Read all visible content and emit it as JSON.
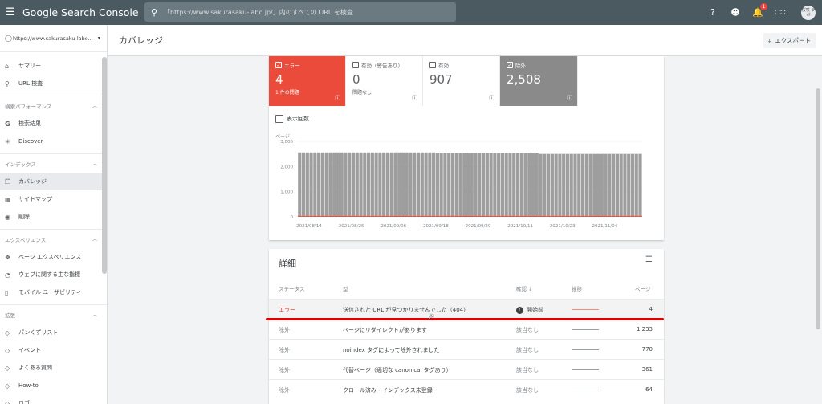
{
  "header": {
    "brand": "Google Search Console",
    "search_placeholder": "「https://www.sakurasaku-labo.jp/」内のすべての URL を検査",
    "notification_count": "1",
    "avatar_text": "桜咲 ラボ"
  },
  "sidebar": {
    "property": "https://www.sakurasaku-labo...",
    "top_items": [
      {
        "label": "サマリー",
        "icon": "home-icon"
      },
      {
        "label": "URL 検査",
        "icon": "search-icon"
      }
    ],
    "sections": [
      {
        "title": "検索パフォーマンス",
        "items": [
          {
            "label": "検索結果",
            "icon": "google-g-icon"
          },
          {
            "label": "Discover",
            "icon": "asterisk-icon"
          }
        ]
      },
      {
        "title": "インデックス",
        "items": [
          {
            "label": "カバレッジ",
            "icon": "file-copy-icon"
          },
          {
            "label": "サイトマップ",
            "icon": "sitemap-icon"
          },
          {
            "label": "削除",
            "icon": "eye-off-icon"
          }
        ]
      },
      {
        "title": "エクスペリエンス",
        "items": [
          {
            "label": "ページ エクスペリエンス",
            "icon": "target-icon"
          },
          {
            "label": "ウェブに関する主な指標",
            "icon": "speed-icon"
          },
          {
            "label": "モバイル ユーザビリティ",
            "icon": "phone-icon"
          }
        ]
      },
      {
        "title": "拡張",
        "items": [
          {
            "label": "パンくずリスト",
            "icon": "diamond-icon"
          },
          {
            "label": "イベント",
            "icon": "diamond-icon"
          },
          {
            "label": "よくある質問",
            "icon": "diamond-icon"
          },
          {
            "label": "How-to",
            "icon": "diamond-icon"
          },
          {
            "label": "ロゴ",
            "icon": "diamond-icon"
          }
        ]
      }
    ]
  },
  "page": {
    "title": "カバレッジ",
    "export_label": "エクスポート"
  },
  "tiles": [
    {
      "label": "エラー",
      "value": "4",
      "sub": "1 件の問題",
      "checked": true
    },
    {
      "label": "有効（警告あり）",
      "value": "0",
      "sub": "問題なし",
      "checked": false
    },
    {
      "label": "有効",
      "value": "907",
      "sub": "",
      "checked": false
    },
    {
      "label": "除外",
      "value": "2,508",
      "sub": "",
      "checked": true
    }
  ],
  "impressions_label": "表示回数",
  "chart_data": {
    "type": "bar",
    "ylabel": "ページ",
    "yticks": [
      "3,000",
      "2,000",
      "1,000",
      "0"
    ],
    "ylim": [
      0,
      3000
    ],
    "xticks": [
      "2021/08/14",
      "2021/08/25",
      "2021/09/06",
      "2021/09/18",
      "2021/09/29",
      "2021/10/11",
      "2021/10/23",
      "2021/11/04"
    ],
    "series": [
      {
        "name": "除外",
        "color": "#9e9e9e",
        "values_start": 2560,
        "values_mid": 2530,
        "values_end": 2500
      },
      {
        "name": "エラー",
        "color": "#eb4b3a",
        "values_start": 4,
        "values_mid": 4,
        "values_end": 4
      }
    ],
    "bar_count": 90
  },
  "details": {
    "title": "詳細",
    "columns": {
      "status": "ステータス",
      "type": "型",
      "validation": "確認",
      "trend": "推移",
      "pages": "ページ"
    },
    "rows": [
      {
        "status": "エラー",
        "type": "送信された URL が見つかりませんでした（404）",
        "validation": "開始前",
        "pages": "4"
      },
      {
        "status": "除外",
        "type": "ページにリダイレクトがあります",
        "validation": "該当なし",
        "pages": "1,233"
      },
      {
        "status": "除外",
        "type": "noindex タグによって除外されました",
        "validation": "該当なし",
        "pages": "770"
      },
      {
        "status": "除外",
        "type": "代替ページ（適切な canonical タグあり）",
        "validation": "該当なし",
        "pages": "361"
      },
      {
        "status": "除外",
        "type": "クロール済み - インデックス未登録",
        "validation": "該当なし",
        "pages": "64"
      }
    ]
  }
}
